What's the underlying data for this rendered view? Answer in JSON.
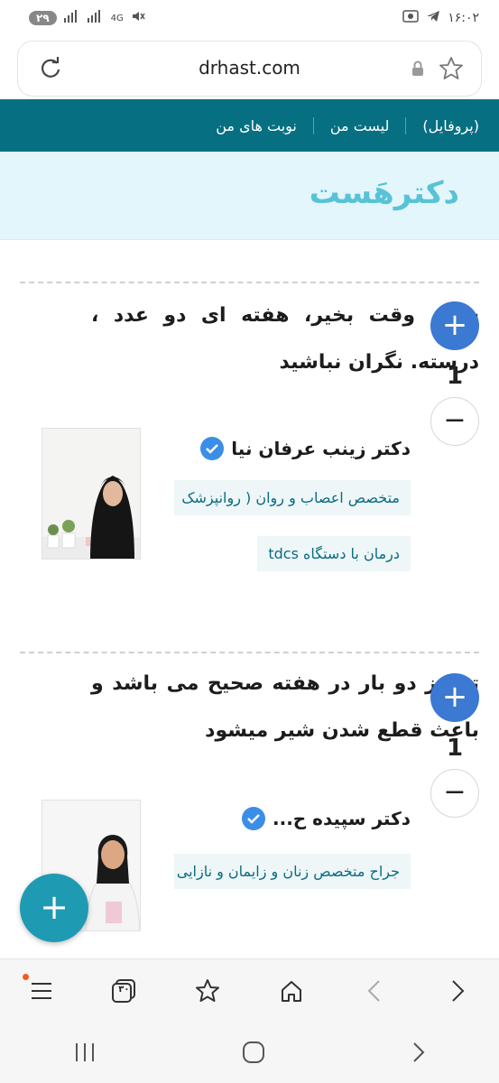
{
  "status_bar": {
    "time": "۱۶:۰۲",
    "battery": "۲۹",
    "network": "4G"
  },
  "browser": {
    "url": "drhast.com"
  },
  "top_nav": {
    "items": [
      {
        "label": "(پروفایل)"
      },
      {
        "label": "لیست من"
      },
      {
        "label": "نوبت های من"
      }
    ]
  },
  "brand": {
    "logo_text": "دکترهَست"
  },
  "answers": [
    {
      "text": "سلام وقت بخیر، هفته ای دو عدد ، درسته. نگران نباشید",
      "votes": "1",
      "doctor": {
        "name": "دکتر زینب عرفان نیا",
        "specialty": "متخصص اعصاب و روان ( روانپزشک",
        "extra": "درمان با دستگاه tdcs"
      }
    },
    {
      "text": "تجویز دو بار در هفته صحیح می باشد و باعث قطع شدن شیر میشود",
      "votes": "1",
      "doctor": {
        "name": "دکتر سپیده ح...",
        "specialty": "جراح متخصص زنان و زایمان و نازایی"
      }
    }
  ],
  "fab": {
    "label": "+"
  },
  "bottom_toolbar": {
    "tabs_count": "۳۰"
  },
  "colors": {
    "nav_bg": "#076f82",
    "brand_bg": "#e3f6fc",
    "logo": "#58c3d6",
    "vote_plus": "#3b79d2",
    "fab": "#1f9ab3",
    "tag_bg": "#eef6f8",
    "tag_text": "#0a6d7e"
  }
}
